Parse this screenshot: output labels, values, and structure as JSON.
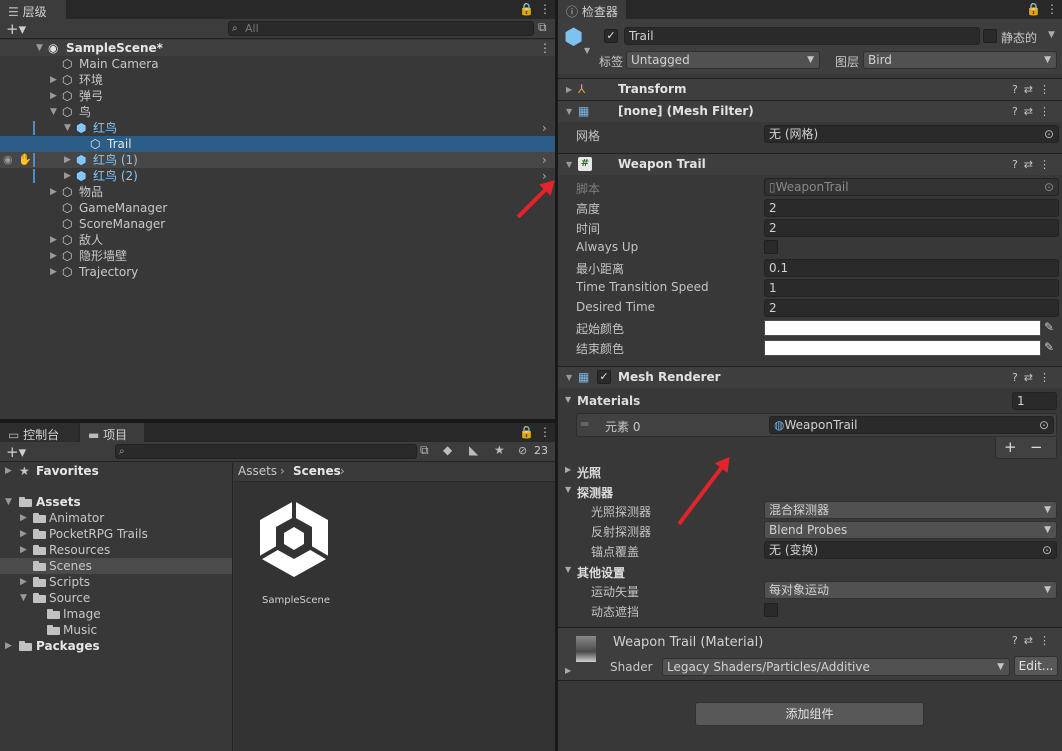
{
  "hierarchy": {
    "tab": "层级",
    "search_placeholder": "All",
    "scene": "SampleScene*",
    "items": [
      {
        "label": "Main Camera"
      },
      {
        "label": "环境"
      },
      {
        "label": "弹弓"
      },
      {
        "label": "鸟"
      },
      {
        "label": "红鸟"
      },
      {
        "label": "Trail"
      },
      {
        "label": "红鸟 (1)"
      },
      {
        "label": "红鸟 (2)"
      },
      {
        "label": "物品"
      },
      {
        "label": "GameManager"
      },
      {
        "label": "ScoreManager"
      },
      {
        "label": "敌人"
      },
      {
        "label": "隐形墙壁"
      },
      {
        "label": "Trajectory"
      }
    ]
  },
  "project": {
    "tab_console": "控制台",
    "tab_project": "项目",
    "hidden_count": "23",
    "favorites": "Favorites",
    "assets": "Assets",
    "folders": [
      "Animator",
      "PocketRPG Trails",
      "Resources",
      "Scenes",
      "Scripts",
      "Source",
      "Image",
      "Music"
    ],
    "packages": "Packages",
    "breadcrumb": {
      "root": "Assets",
      "current": "Scenes"
    },
    "scene_asset": "SampleScene"
  },
  "inspector": {
    "tab": "检查器",
    "object_name": "Trail",
    "static_label": "静态的",
    "tag_label": "标签",
    "tag_value": "Untagged",
    "layer_label": "图层",
    "layer_value": "Bird",
    "transform": "Transform",
    "mesh_filter": "[none] (Mesh Filter)",
    "mesh_label": "网格",
    "mesh_value": "无 (网格)",
    "weapon_trail": "Weapon Trail",
    "script_label": "脚本",
    "script_value": "WeaponTrail",
    "props": [
      {
        "label": "高度",
        "value": "2"
      },
      {
        "label": "时间",
        "value": "2"
      },
      {
        "label": "Always Up",
        "value": ""
      },
      {
        "label": "最小距离",
        "value": "0.1"
      },
      {
        "label": "Time Transition Speed",
        "value": "1"
      },
      {
        "label": "Desired Time",
        "value": "2"
      }
    ],
    "start_color_label": "起始颜色",
    "end_color_label": "结束颜色",
    "mesh_renderer": "Mesh Renderer",
    "materials_label": "Materials",
    "materials_count": "1",
    "element_label": "元素 0",
    "element_value": "WeaponTrail",
    "lighting": "光照",
    "probes": "探测器",
    "light_probes_label": "光照探测器",
    "light_probes_value": "混合探测器",
    "reflection_probes_label": "反射探测器",
    "reflection_probes_value": "Blend Probes",
    "anchor_label": "锚点覆盖",
    "anchor_value": "无 (变换)",
    "other_settings": "其他设置",
    "motion_label": "运动矢量",
    "motion_value": "每对象运动",
    "occlusion_label": "动态遮挡",
    "material_name": "Weapon Trail (Material)",
    "shader_label": "Shader",
    "shader_value": "Legacy Shaders/Particles/Additive",
    "edit_button": "Edit...",
    "add_component": "添加组件",
    "colors": {
      "accent": "#2c5d87",
      "arrow": "#e4242a"
    }
  }
}
